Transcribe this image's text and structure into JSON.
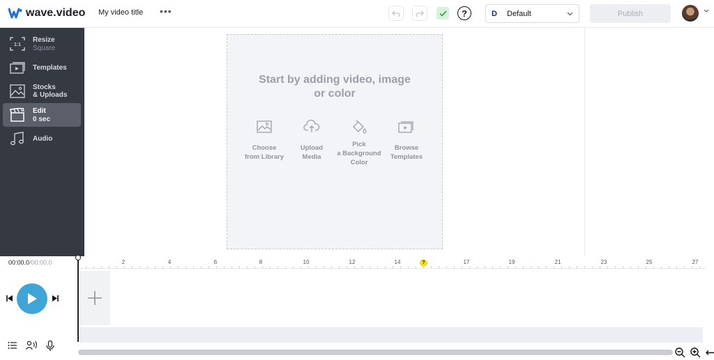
{
  "app": {
    "logo_text": "wave.video"
  },
  "header": {
    "video_title": "My video title",
    "more_label": "•••",
    "undo_icon": "undo-icon",
    "redo_icon": "redo-icon",
    "saved_icon": "check-icon",
    "help_label": "?",
    "brand_select": {
      "letter": "D",
      "value": "Default"
    },
    "publish_label": "Publish"
  },
  "sidebar": {
    "items": [
      {
        "label": "Resize",
        "sub": "Square",
        "icon": "resize-icon",
        "badge": "1:1"
      },
      {
        "label": "Templates",
        "sub": "",
        "icon": "templates-icon"
      },
      {
        "label": "Stocks",
        "sub": "& Uploads",
        "icon": "image-icon"
      },
      {
        "label": "Edit",
        "sub": "0 sec",
        "icon": "clapperboard-icon"
      },
      {
        "label": "Audio",
        "sub": "",
        "icon": "music-icon"
      }
    ]
  },
  "canvas": {
    "heading_line1": "Start by adding video, image",
    "heading_line2": "or color",
    "options": [
      {
        "line1": "Choose",
        "line2": "from Library",
        "line3": "",
        "icon": "image-icon"
      },
      {
        "line1": "Upload",
        "line2": "Media",
        "line3": "",
        "icon": "cloud-upload-icon"
      },
      {
        "line1": "Pick",
        "line2": "a Background",
        "line3": "Color",
        "icon": "paint-bucket-icon"
      },
      {
        "line1": "Browse",
        "line2": "Templates",
        "line3": "",
        "icon": "templates-icon"
      }
    ]
  },
  "timeline": {
    "current_time": "00:00.0",
    "total_time": "/00:00.0",
    "ruler_labels": [
      "2",
      "4",
      "6",
      "8",
      "10",
      "12",
      "14",
      "17",
      "19",
      "21",
      "23",
      "25",
      "27"
    ],
    "marker_label": "?"
  },
  "colors": {
    "accent": "#3fa4d6",
    "sidebar_bg": "#353942",
    "logo_blue": "#1f6fe0"
  }
}
